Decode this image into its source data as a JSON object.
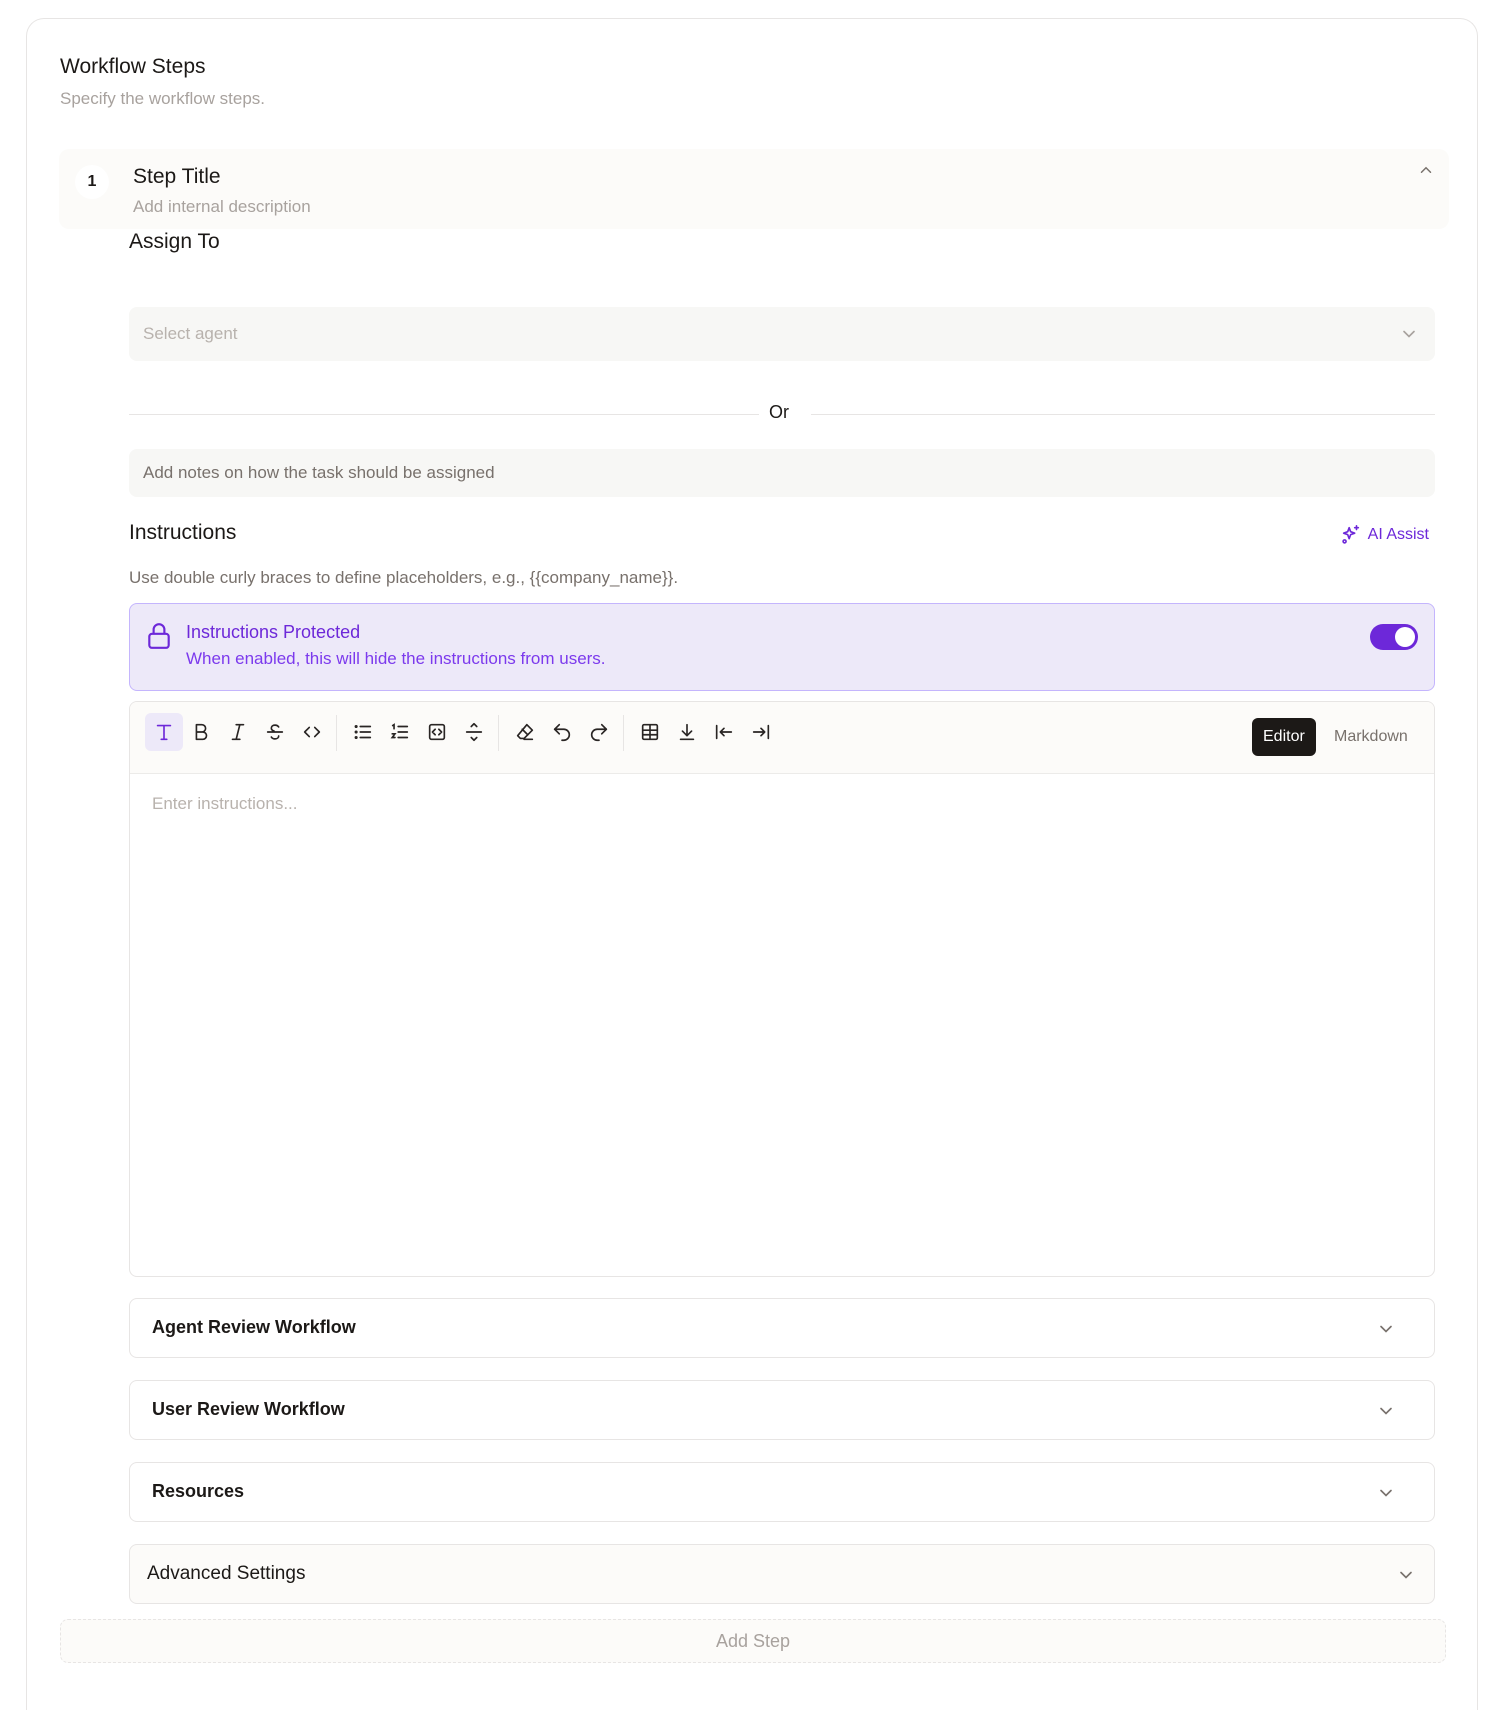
{
  "section": {
    "title": "Workflow Steps",
    "subtitle": "Specify the workflow steps."
  },
  "step": {
    "number": "1",
    "title": "Step Title",
    "description_placeholder": "Add internal description"
  },
  "assign": {
    "label": "Assign To",
    "select_placeholder": "Select agent",
    "or_text": "Or",
    "notes_placeholder": "Add notes on how the task should be assigned"
  },
  "instructions": {
    "label": "Instructions",
    "ai_assist_label": "AI Assist",
    "hint": "Use double curly braces to define placeholders, e.g., {{company_name}}.",
    "protected_title": "Instructions Protected",
    "protected_desc": "When enabled, this will hide the instructions from users.",
    "protected_enabled": true,
    "editor_placeholder": "Enter instructions...",
    "mode_editor": "Editor",
    "mode_markdown": "Markdown",
    "active_mode": "Editor",
    "toolbar": [
      "text-icon",
      "bold-icon",
      "italic-icon",
      "strikethrough-icon",
      "code-icon",
      "bullet-list-icon",
      "ordered-list-icon",
      "code-block-icon",
      "horizontal-rule-icon",
      "eraser-icon",
      "undo-icon",
      "redo-icon",
      "table-icon",
      "download-icon",
      "outdent-icon",
      "indent-icon"
    ]
  },
  "accordions": [
    {
      "label": "Agent Review Workflow"
    },
    {
      "label": "User Review Workflow"
    },
    {
      "label": "Resources"
    },
    {
      "label": "Advanced Settings"
    }
  ],
  "add_step_label": "Add Step",
  "colors": {
    "accent": "#6d28d9",
    "protected_bg": "#ede9f9"
  }
}
